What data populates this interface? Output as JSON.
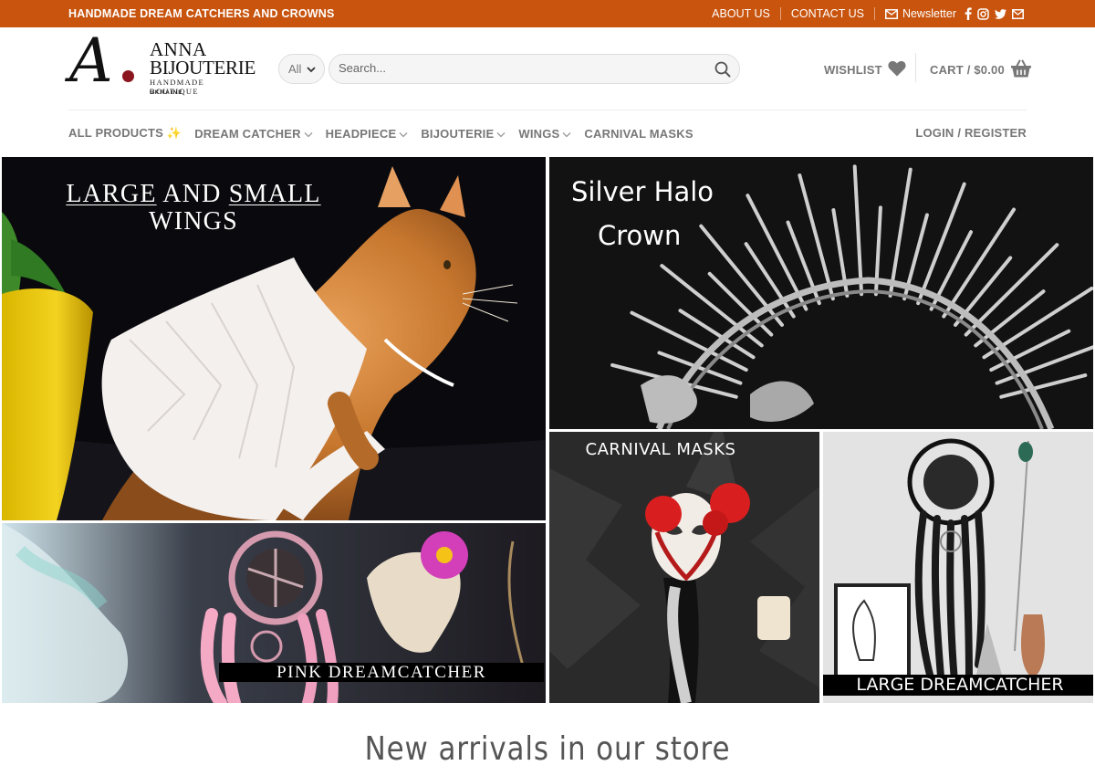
{
  "topbar": {
    "tagline": "HANDMADE DREAM CATCHERS AND CROWNS",
    "about": "ABOUT US",
    "contact": "CONTACT US",
    "newsletter": "Newsletter",
    "social_icons": [
      "facebook-icon",
      "instagram-icon",
      "twitter-icon",
      "email-icon"
    ],
    "bg_color": "#c8540e"
  },
  "logo": {
    "mark": "A",
    "name_line1": "ANNA",
    "name_line2": "BIJOUTERIE",
    "tagline": "HANDMADE BOUTIQUE",
    "country": "UKRAINE",
    "dot_color": "#8b1620"
  },
  "search": {
    "category": "All",
    "placeholder": "Search..."
  },
  "header": {
    "wishlist": "WISHLIST",
    "cart": "CART / $0.00"
  },
  "nav": {
    "items": [
      {
        "label": "ALL PRODUCTS ✨",
        "dropdown": false
      },
      {
        "label": "DREAM CATCHER",
        "dropdown": true
      },
      {
        "label": "HEADPIECE",
        "dropdown": true
      },
      {
        "label": "BIJOUTERIE",
        "dropdown": true
      },
      {
        "label": "WINGS",
        "dropdown": true
      },
      {
        "label": "CARNIVAL MASKS",
        "dropdown": false
      }
    ],
    "login": "LOGIN / REGISTER"
  },
  "banners": {
    "wings": {
      "line1a": "LARGE",
      "line1b": "AND",
      "line1c": "SMALL",
      "line2": "WINGS"
    },
    "halo": {
      "line1": "Silver Halo",
      "line2": "Crown"
    },
    "masks": {
      "label": "CARNIVAL MASKS"
    },
    "pink": {
      "label": "PINK DREAMCATCHER"
    },
    "large": {
      "label": "LARGE DREAMCATCHER"
    }
  },
  "section": {
    "title": "New arrivals in our store"
  }
}
